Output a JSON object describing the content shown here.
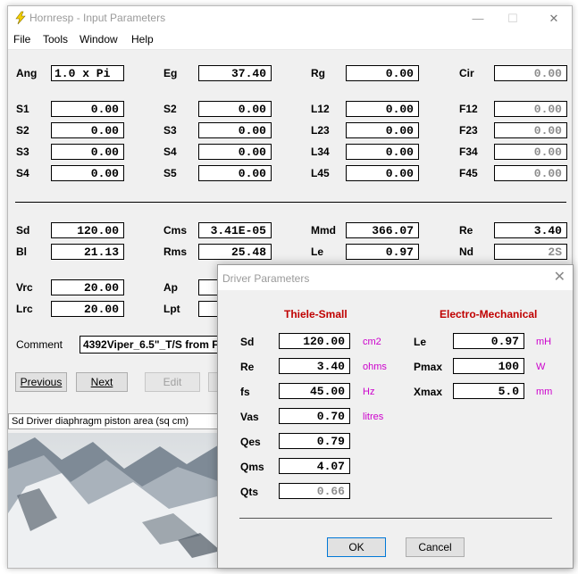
{
  "window": {
    "title": "Hornresp - Input Parameters",
    "min": "—",
    "max": "☐",
    "close": "✕"
  },
  "menu": [
    "File",
    "Tools",
    "Window",
    "Help"
  ],
  "params": {
    "ang": {
      "label": "Ang",
      "value": "1.0 x Pi"
    },
    "eg": {
      "label": "Eg",
      "value": "37.40"
    },
    "rg": {
      "label": "Rg",
      "value": "0.00"
    },
    "cir": {
      "label": "Cir",
      "value": "0.00"
    },
    "s1": {
      "label": "S1",
      "value": "0.00"
    },
    "s2": {
      "label": "S2",
      "value": "0.00"
    },
    "s3": {
      "label": "S3",
      "value": "0.00"
    },
    "s4": {
      "label": "S4",
      "value": "0.00"
    },
    "s2b": {
      "label": "S2",
      "value": "0.00"
    },
    "s3b": {
      "label": "S3",
      "value": "0.00"
    },
    "s4b": {
      "label": "S4",
      "value": "0.00"
    },
    "s5": {
      "label": "S5",
      "value": "0.00"
    },
    "l12": {
      "label": "L12",
      "value": "0.00"
    },
    "l23": {
      "label": "L23",
      "value": "0.00"
    },
    "l34": {
      "label": "L34",
      "value": "0.00"
    },
    "l45": {
      "label": "L45",
      "value": "0.00"
    },
    "f12": {
      "label": "F12",
      "value": "0.00"
    },
    "f23": {
      "label": "F23",
      "value": "0.00"
    },
    "f34": {
      "label": "F34",
      "value": "0.00"
    },
    "f45": {
      "label": "F45",
      "value": "0.00"
    },
    "sd": {
      "label": "Sd",
      "value": "120.00"
    },
    "cms": {
      "label": "Cms",
      "value": "3.41E-05"
    },
    "mmd": {
      "label": "Mmd",
      "value": "366.07"
    },
    "re": {
      "label": "Re",
      "value": "3.40"
    },
    "bl": {
      "label": "Bl",
      "value": "21.13"
    },
    "rms": {
      "label": "Rms",
      "value": "25.48"
    },
    "le": {
      "label": "Le",
      "value": "0.97"
    },
    "nd": {
      "label": "Nd",
      "value": "2S"
    },
    "vrc": {
      "label": "Vrc",
      "value": "20.00"
    },
    "ap": {
      "label": "Ap"
    },
    "lrc": {
      "label": "Lrc",
      "value": "20.00"
    },
    "lpt": {
      "label": "Lpt"
    }
  },
  "comment": {
    "label": "Comment",
    "value": "4392Viper_6.5\"_T/S from F"
  },
  "buttons": {
    "previous": "Previous",
    "next": "Next",
    "edit": "Edit"
  },
  "status": "Sd   Driver diaphragm piston area  (sq cm)",
  "dialog": {
    "title": "Driver Parameters",
    "close": "✕",
    "left_header": "Thiele-Small",
    "right_header": "Electro-Mechanical",
    "left": [
      {
        "label": "Sd",
        "value": "120.00",
        "unit": "cm2"
      },
      {
        "label": "Re",
        "value": "3.40",
        "unit": "ohms"
      },
      {
        "label": "fs",
        "value": "45.00",
        "unit": "Hz"
      },
      {
        "label": "Vas",
        "value": "0.70",
        "unit": "litres"
      },
      {
        "label": "Qes",
        "value": "0.79",
        "unit": ""
      },
      {
        "label": "Qms",
        "value": "4.07",
        "unit": ""
      },
      {
        "label": "Qts",
        "value": "0.66",
        "unit": ""
      }
    ],
    "right": [
      {
        "label": "Le",
        "value": "0.97",
        "unit": "mH"
      },
      {
        "label": "Pmax",
        "value": "100",
        "unit": "W"
      },
      {
        "label": "Xmax",
        "value": "5.0",
        "unit": "mm"
      }
    ],
    "ok": "OK",
    "cancel": "Cancel"
  }
}
